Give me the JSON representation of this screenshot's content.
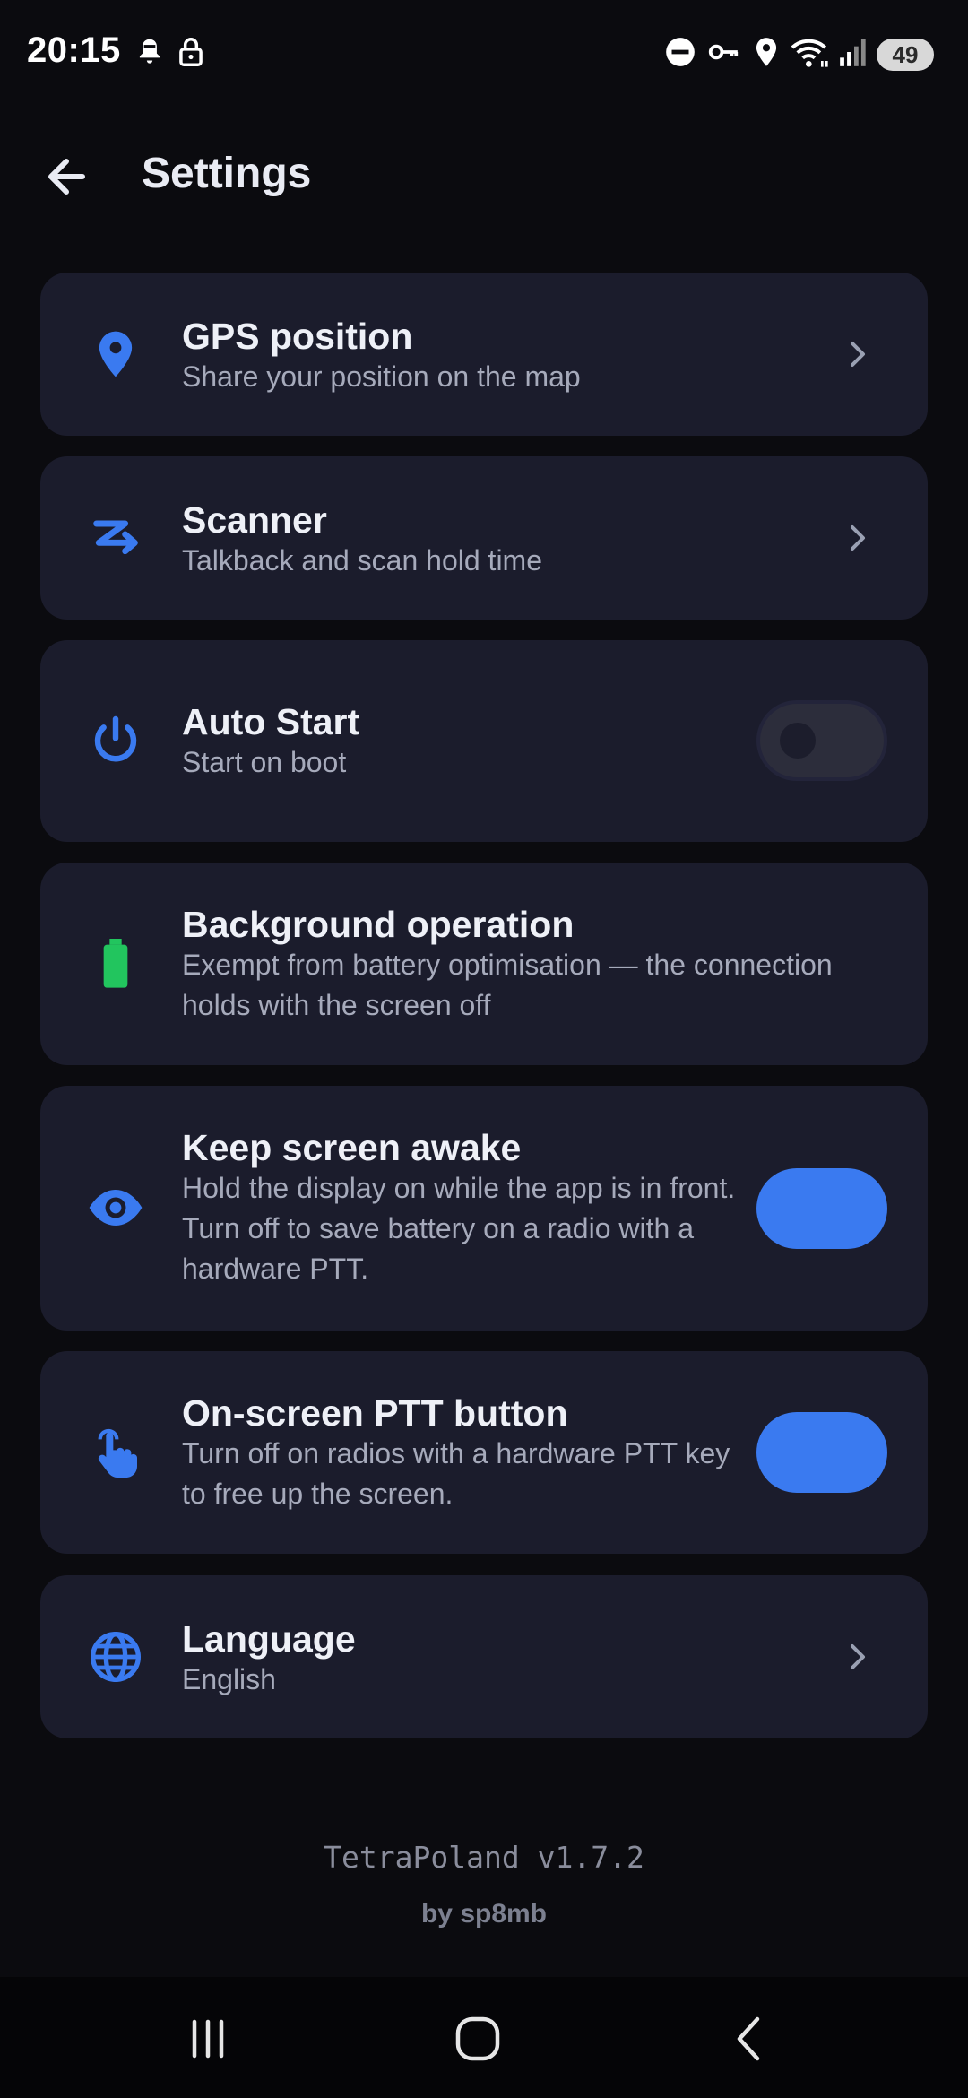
{
  "status_bar": {
    "time": "20:15",
    "battery": "49",
    "icons": [
      "notification-bell-icon",
      "lock-icon",
      "dnd-icon",
      "vpn-key-icon",
      "location-icon",
      "wifi-icon",
      "signal-icon"
    ]
  },
  "header": {
    "back_icon": "arrow-left-icon",
    "title": "Settings"
  },
  "settings": [
    {
      "key": "gps",
      "icon": "location-pin-icon",
      "title": "GPS position",
      "subtitle": "Share your position on the map",
      "control": "chevron"
    },
    {
      "key": "scanner",
      "icon": "scanner-icon",
      "title": "Scanner",
      "subtitle": "Talkback and scan hold time",
      "control": "chevron"
    },
    {
      "key": "auto_start",
      "icon": "power-icon",
      "title": "Auto Start",
      "subtitle": "Start on boot",
      "control": "toggle",
      "enabled": false
    },
    {
      "key": "background",
      "icon": "battery-icon",
      "title": "Background operation",
      "subtitle_lines": [
        "Exempt from battery optimisation — the connection",
        "holds with the screen off"
      ],
      "control": "none"
    },
    {
      "key": "keep_awake",
      "icon": "eye-icon",
      "title": "Keep screen awake",
      "subtitle_lines": [
        "Hold the display on while the app is in front.",
        "Turn off to save battery on a radio with a",
        "hardware PTT."
      ],
      "control": "toggle",
      "enabled": true
    },
    {
      "key": "ptt",
      "icon": "touch-icon",
      "title": "On-screen PTT button",
      "subtitle_lines": [
        "Turn off on radios with a hardware PTT key",
        "to free up the screen."
      ],
      "control": "toggle",
      "enabled": true
    },
    {
      "key": "language",
      "icon": "globe-icon",
      "title": "Language",
      "subtitle": "English",
      "control": "chevron"
    }
  ],
  "footer": {
    "version": "TetraPoland v1.7.2",
    "author": "by sp8mb"
  },
  "colors": {
    "background": "#0b0b0f",
    "card": "#1b1c2c",
    "accent": "#3a7af0",
    "battery_green": "#22c55e"
  },
  "nav": {
    "recents_icon": "recents-icon",
    "home_icon": "home-icon",
    "back_icon": "back-chevron-icon"
  }
}
